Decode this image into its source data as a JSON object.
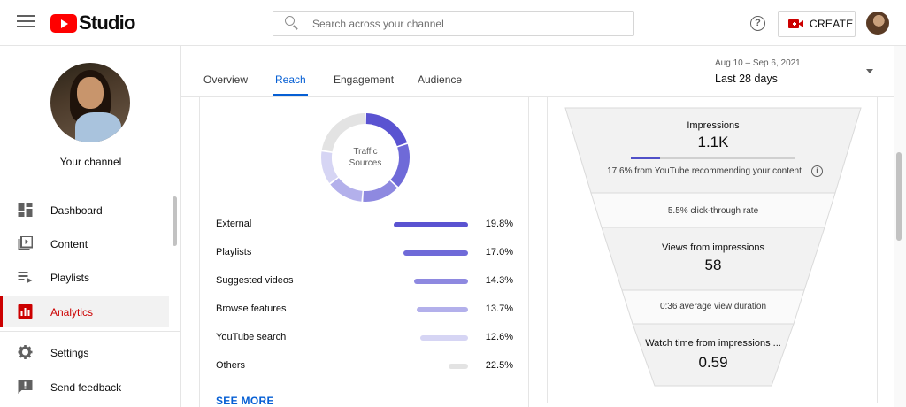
{
  "header": {
    "logo_text": "Studio",
    "search_placeholder": "Search across your channel",
    "create_label": "CREATE"
  },
  "sidebar": {
    "channel_label": "Your channel",
    "items": [
      {
        "label": "Dashboard",
        "icon": "dashboard-icon"
      },
      {
        "label": "Content",
        "icon": "content-icon"
      },
      {
        "label": "Playlists",
        "icon": "playlists-icon"
      },
      {
        "label": "Analytics",
        "icon": "analytics-icon",
        "active": true
      },
      {
        "label": "Settings",
        "icon": "gear-icon"
      },
      {
        "label": "Send feedback",
        "icon": "feedback-icon"
      }
    ]
  },
  "tabs": [
    {
      "label": "Overview"
    },
    {
      "label": "Reach",
      "active": true
    },
    {
      "label": "Engagement"
    },
    {
      "label": "Audience"
    }
  ],
  "date_range": {
    "dates": "Aug 10 – Sep 6, 2021",
    "label": "Last 28 days"
  },
  "traffic_sources": {
    "donut_label_line1": "Traffic",
    "donut_label_line2": "Sources",
    "rows": [
      {
        "name": "External",
        "percent": "19.8%",
        "value": 19.8,
        "color": "#5a53d1"
      },
      {
        "name": "Playlists",
        "percent": "17.0%",
        "value": 17.0,
        "color": "#6f6ad8"
      },
      {
        "name": "Suggested videos",
        "percent": "14.3%",
        "value": 14.3,
        "color": "#8e89e0"
      },
      {
        "name": "Browse features",
        "percent": "13.7%",
        "value": 13.7,
        "color": "#b3b0eb"
      },
      {
        "name": "YouTube search",
        "percent": "12.6%",
        "value": 12.6,
        "color": "#d6d5f4"
      },
      {
        "name": "Others",
        "percent": "22.5%",
        "value": 22.5,
        "color": "#e3e3e3"
      }
    ],
    "see_more": "SEE MORE"
  },
  "funnel": {
    "impressions_label": "Impressions",
    "impressions_value": "1.1K",
    "recommend_text": "17.6% from YouTube recommending your content",
    "recommend_fraction": 0.176,
    "ctr_text": "5.5% click-through rate",
    "views_label": "Views from impressions",
    "views_value": "58",
    "avd_text": "0:36 average view duration",
    "watch_label": "Watch time from impressions ...",
    "watch_value": "0.59"
  }
}
